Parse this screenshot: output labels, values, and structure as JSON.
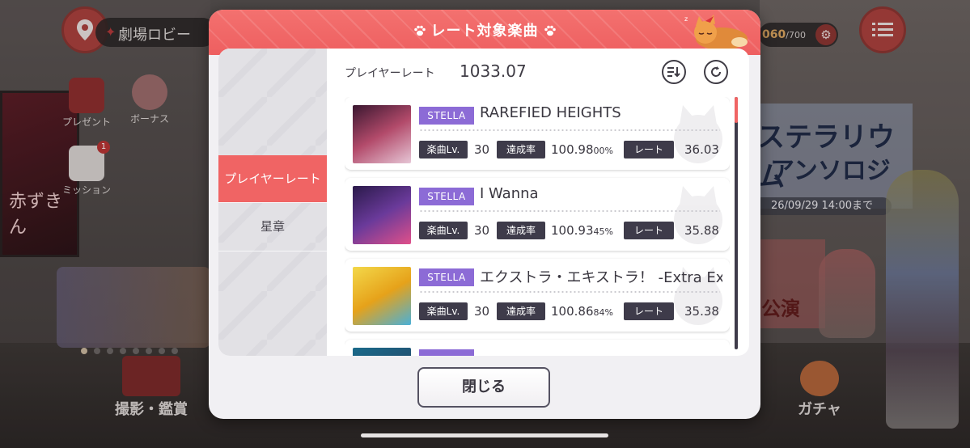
{
  "background": {
    "location_label": "劇場ロビー",
    "stamina": {
      "current": "060",
      "max": "/700"
    },
    "side_items": [
      {
        "label": "プレゼント"
      },
      {
        "label": "ボーナス"
      },
      {
        "label": "ミッション",
        "badge": "1"
      }
    ],
    "poster_text": "赤ずきん",
    "banner": {
      "line1": "ステラリウム",
      "line2": "アンソロジー",
      "date": "26/09/29 14:00まで"
    },
    "campaign": {
      "text": "公演"
    },
    "bottom_buttons": [
      {
        "label": "撮影・鑑賞"
      },
      {
        "label": "ガチャ"
      }
    ]
  },
  "modal": {
    "title": "レート対象楽曲",
    "tabs": [
      {
        "label": "プレイヤーレート",
        "active": true
      },
      {
        "label": "星章",
        "active": false
      }
    ],
    "player_rate_label": "プレイヤーレート",
    "player_rate_value": "1033.07",
    "songs": [
      {
        "difficulty": "STELLA",
        "title": "RAREFIED HEIGHTS",
        "level_label": "楽曲Lv.",
        "level": "30",
        "achieve_label": "達成率",
        "achieve_main": "100.98",
        "achieve_sub": "00%",
        "rate_label": "レート",
        "rate": "36.03",
        "jacket_colors": [
          "#3a1730",
          "#b24a6a",
          "#e6c6d6"
        ]
      },
      {
        "difficulty": "STELLA",
        "title": "I Wanna",
        "level_label": "楽曲Lv.",
        "level": "30",
        "achieve_label": "達成率",
        "achieve_main": "100.93",
        "achieve_sub": "45%",
        "rate_label": "レート",
        "rate": "35.88",
        "jacket_colors": [
          "#2a1a4a",
          "#6a3a9a",
          "#e0508a"
        ]
      },
      {
        "difficulty": "STELLA",
        "title": "エクストラ・エキストラ！ -Extra Extra-",
        "level_label": "楽曲Lv.",
        "level": "30",
        "achieve_label": "達成率",
        "achieve_main": "100.86",
        "achieve_sub": "84%",
        "rate_label": "レート",
        "rate": "35.38",
        "jacket_colors": [
          "#f3d84a",
          "#e6a21a",
          "#4ab0d8"
        ]
      }
    ],
    "partial_song": {
      "jacket_colors": [
        "#1a6a8a",
        "#2a3a5a"
      ]
    },
    "close_label": "閉じる",
    "colors": {
      "accent": "#f06464",
      "difficulty": "#8c6bd6",
      "tag": "#3e3b4a"
    }
  }
}
